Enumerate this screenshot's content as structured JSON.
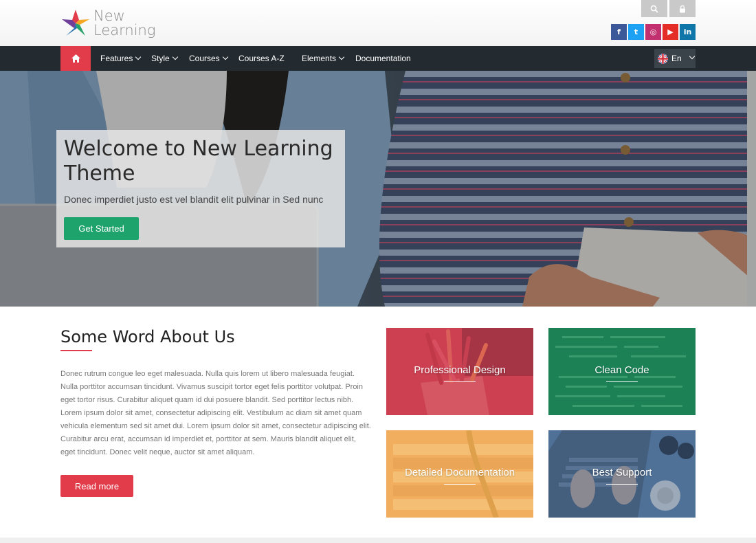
{
  "brand": {
    "line1": "New",
    "line2": "Learning"
  },
  "header": {
    "search_icon": "search-icon",
    "lock_icon": "lock-icon",
    "social": [
      {
        "name": "facebook",
        "glyph": "f",
        "color": "#3b5998"
      },
      {
        "name": "twitter",
        "glyph": "t",
        "color": "#1da1f2"
      },
      {
        "name": "instagram",
        "glyph": "◎",
        "color": "#c2306f"
      },
      {
        "name": "youtube",
        "glyph": "▶",
        "color": "#e52d27"
      },
      {
        "name": "linkedin",
        "glyph": "in",
        "color": "#0e76a8"
      }
    ]
  },
  "nav": {
    "home_icon": "home-icon",
    "items": [
      {
        "label": "Features",
        "dropdown": true
      },
      {
        "label": "Style",
        "dropdown": true
      },
      {
        "label": "Courses",
        "dropdown": true
      },
      {
        "label": "Courses A-Z",
        "dropdown": false
      },
      {
        "label": "Elements",
        "dropdown": true
      },
      {
        "label": "Documentation",
        "dropdown": false
      }
    ],
    "language": "En"
  },
  "hero": {
    "title": "Welcome to New Learning Theme",
    "subtitle": "Donec imperdiet justo est vel blandit elit pulvinar in Sed nunc",
    "cta": "Get Started"
  },
  "about": {
    "title": "Some Word About Us",
    "text": "Donec rutrum congue leo eget malesuada. Nulla quis lorem ut libero malesuada feugiat. Nulla porttitor accumsan tincidunt. Vivamus suscipit tortor eget felis porttitor volutpat. Proin eget tortor risus. Curabitur aliquet quam id dui posuere blandit. Sed porttitor lectus nibh. Lorem ipsum dolor sit amet, consectetur adipiscing elit. Vestibulum ac diam sit amet quam vehicula elementum sed sit amet dui. Lorem ipsum dolor sit amet, consectetur adipiscing elit. Curabitur arcu erat, accumsan id imperdiet et, porttitor at sem. Mauris blandit aliquet elit, eget tincidunt. Donec velit neque, auctor sit amet aliquam.",
    "button": "Read more"
  },
  "tiles": [
    {
      "label": "Professional Design",
      "overlay": "#c8394a"
    },
    {
      "label": "Clean Code",
      "overlay": "#1c8a5c"
    },
    {
      "label": "Detailed Documentation",
      "overlay": "#f0a04b"
    },
    {
      "label": "Best Support",
      "overlay": "#3e5f86"
    }
  ],
  "colors": {
    "accent_red": "#e23b4a",
    "nav_bg": "#232a30",
    "green": "#1fa36c"
  }
}
